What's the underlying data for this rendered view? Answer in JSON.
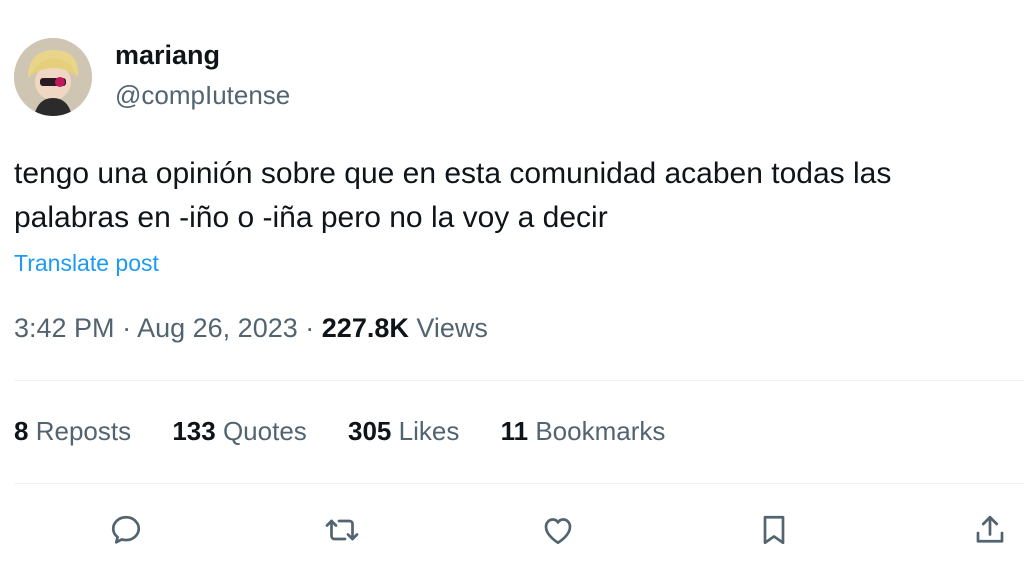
{
  "author": {
    "display_name": "mariang",
    "handle": "@compIutense"
  },
  "tweet": {
    "text": "tengo una opinión sobre que en esta comunidad acaben todas las palabras en -iño o -iña pero no la voy a decir",
    "translate_label": "Translate post"
  },
  "meta": {
    "time": "3:42 PM",
    "separator": "·",
    "date": "Aug 26, 2023",
    "views_count": "227.8K",
    "views_label": "Views"
  },
  "stats": [
    {
      "count": "8",
      "label": "Reposts"
    },
    {
      "count": "133",
      "label": "Quotes"
    },
    {
      "count": "305",
      "label": "Likes"
    },
    {
      "count": "11",
      "label": "Bookmarks"
    }
  ],
  "actions": [
    "reply-icon",
    "repost-icon",
    "like-icon",
    "bookmark-icon",
    "share-icon"
  ],
  "colors": {
    "text": "#0f1419",
    "secondary": "#536471",
    "link": "#1d9bf0",
    "divider": "#eff3f4"
  }
}
